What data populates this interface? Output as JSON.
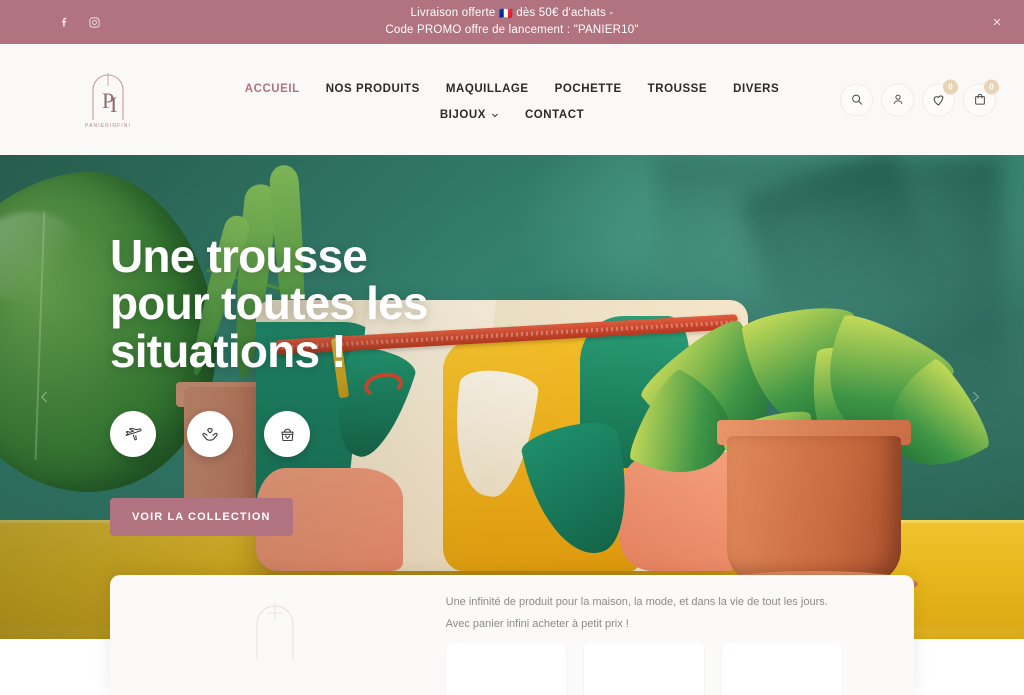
{
  "promo": {
    "line1_before": "Livraison offerte ",
    "flag": "🇫🇷",
    "line1_after": " dès 50€ d'achats -",
    "line2": "Code PROMO offre de lancement : \"PANIER10\"",
    "close_label": "×",
    "social": [
      {
        "name": "facebook-icon",
        "label": "Facebook"
      },
      {
        "name": "instagram-icon",
        "label": "Instagram"
      }
    ],
    "bg_color": "#b0737f"
  },
  "header": {
    "logo": {
      "monogram": "PI",
      "wordmark": "PANIERINFINI"
    },
    "nav_row1": [
      {
        "label": "ACCUEIL",
        "active": true
      },
      {
        "label": "NOS PRODUITS",
        "active": false
      },
      {
        "label": "MAQUILLAGE",
        "active": false
      },
      {
        "label": "POCHETTE",
        "active": false
      },
      {
        "label": "TROUSSE",
        "active": false
      },
      {
        "label": "DIVERS",
        "active": false
      }
    ],
    "nav_row2": [
      {
        "label": "BIJOUX",
        "has_caret": true
      },
      {
        "label": "CONTACT",
        "has_caret": false
      }
    ],
    "icons": [
      {
        "name": "search-icon",
        "badge": null
      },
      {
        "name": "user-icon",
        "badge": null
      },
      {
        "name": "heart-icon",
        "badge": "0"
      },
      {
        "name": "bag-icon",
        "badge": "0"
      }
    ],
    "accent_color": "#b0737f"
  },
  "hero": {
    "title_line1": "Une trousse",
    "title_line2": "pour toutes les",
    "title_line3": "situations !",
    "badges": [
      {
        "name": "airplane-icon"
      },
      {
        "name": "hands-heart-icon"
      },
      {
        "name": "pouch-icon"
      }
    ],
    "cta_label": "VOIR LA COLLECTION",
    "cta_color": "#b0737f",
    "arrow_prev": "prev-slide-arrow",
    "arrow_next": "next-slide-arrow"
  },
  "bottom_card": {
    "description": "Une infinité de produit pour la maison, la mode, et dans la vie de tout les jours. Avec panier infini acheter à petit prix !",
    "tiles": 3
  }
}
